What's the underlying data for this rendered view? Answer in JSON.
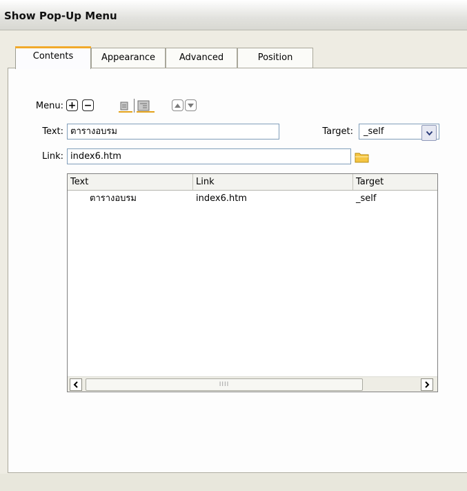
{
  "window": {
    "title": "Show Pop-Up Menu"
  },
  "tabs": [
    {
      "label": "Contents",
      "active": true
    },
    {
      "label": "Appearance",
      "active": false
    },
    {
      "label": "Advanced",
      "active": false
    },
    {
      "label": "Position",
      "active": false
    }
  ],
  "form": {
    "menu_label": "Menu:",
    "text_label": "Text:",
    "text_value": "ตารางอบรม",
    "target_label": "Target:",
    "target_value": "_self",
    "link_label": "Link:",
    "link_value": "index6.htm"
  },
  "toolbar": {
    "add_glyph": "+",
    "remove_glyph": "−"
  },
  "table": {
    "columns": [
      "Text",
      "Link",
      "Target"
    ],
    "rows": [
      {
        "text": "ตารางอบรม",
        "link": "index6.htm",
        "target": "_self"
      }
    ],
    "scroll_grip": "IIII"
  },
  "icons": {
    "add": "plus-icon",
    "remove": "minus-icon",
    "outdent": "outdent-icon",
    "indent": "indent-icon",
    "move_up": "arrow-up-icon",
    "move_down": "arrow-down-icon",
    "dropdown": "chevron-down-icon",
    "browse": "folder-icon",
    "scroll_left": "arrow-left-icon",
    "scroll_right": "arrow-right-icon"
  },
  "colors": {
    "active_tab_accent": "#f1a92a",
    "folder": "#f5c542"
  }
}
